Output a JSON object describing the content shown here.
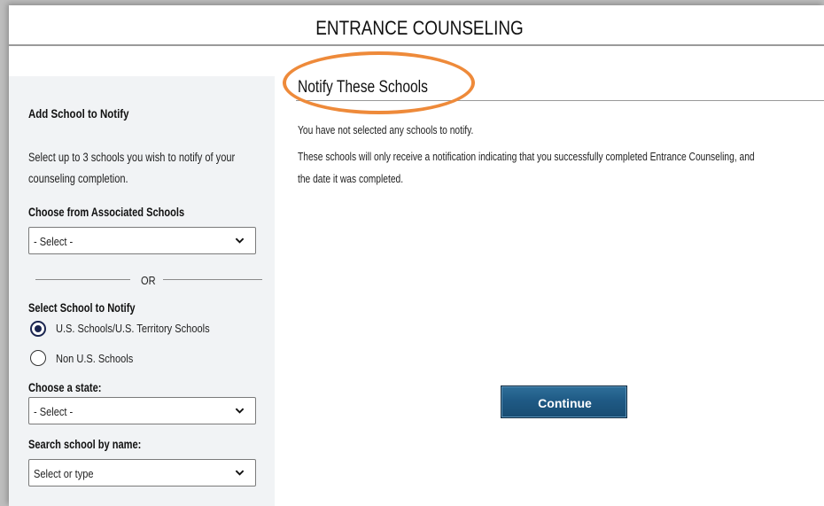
{
  "header": {
    "title": "ENTRANCE COUNSELING"
  },
  "sidebar": {
    "heading": "Add School to Notify",
    "description_line1": "Select up to 3 schools you wish to notify of your",
    "description_line2": "counseling completion.",
    "associated_label": "Choose from Associated Schools",
    "associated_select_value": "- Select -",
    "or_text": "OR",
    "select_school_label": "Select School to Notify",
    "radio_options": [
      {
        "label": "U.S. Schools/U.S. Territory Schools",
        "checked": true
      },
      {
        "label": "Non U.S. Schools",
        "checked": false
      }
    ],
    "state_label": "Choose a state:",
    "state_select_value": "- Select -",
    "search_label": "Search school by name:",
    "search_select_value": "Select or type"
  },
  "main": {
    "title": "Notify These Schools",
    "no_selection_text": "You have not selected any schools to notify.",
    "info_line1": "These schools will only receive a notification indicating that you successfully completed Entrance Counseling, and",
    "info_line2": "the date it was completed.",
    "continue_label": "Continue"
  },
  "colors": {
    "highlight_ellipse": "#ee8a3a",
    "button_blue": "#1f5a85",
    "radio_selected": "#1b2550",
    "sidebar_bg": "#f1f3f5"
  },
  "icons": {
    "dropdown": "chevron-down-icon",
    "radio_selected": "radio-checked-icon",
    "radio_unselected": "radio-unchecked-icon"
  }
}
